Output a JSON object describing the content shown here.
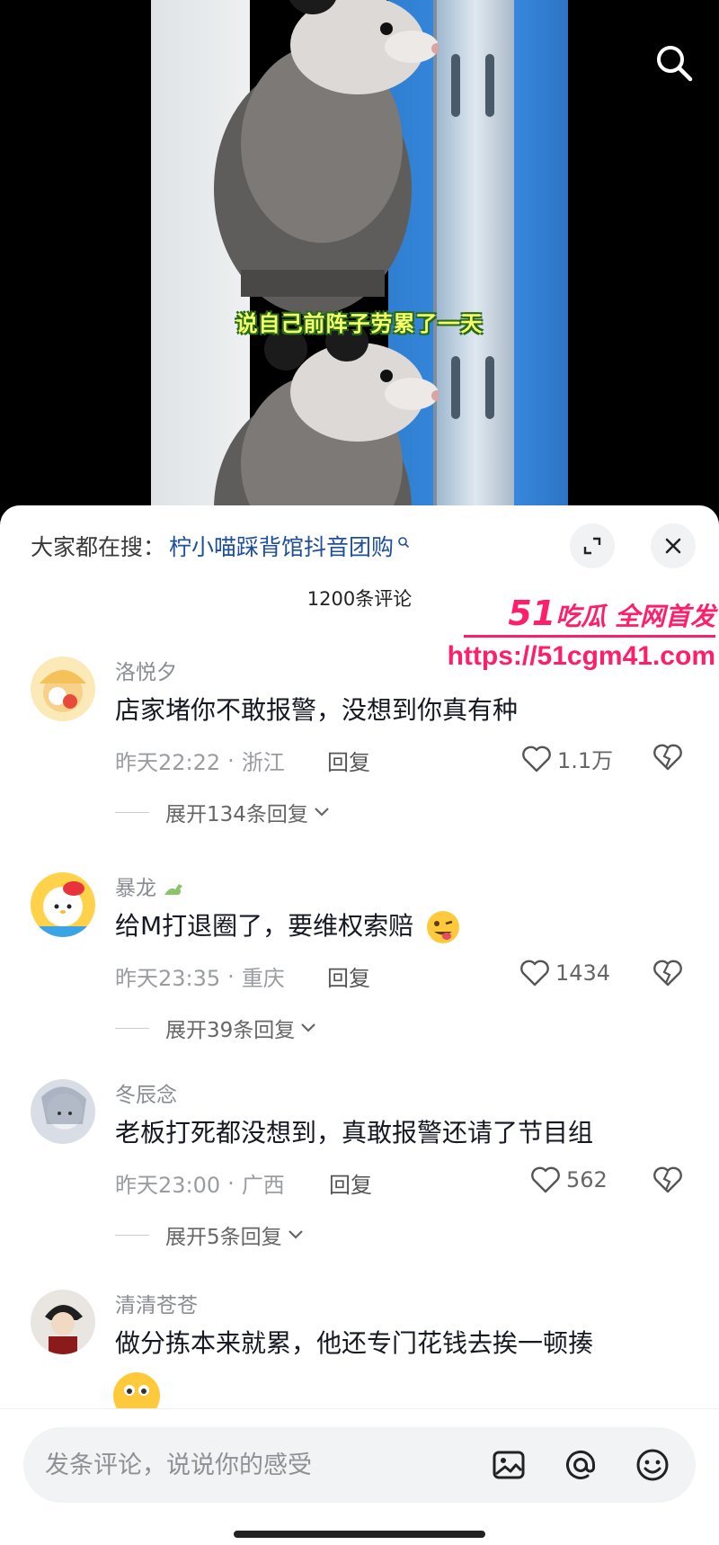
{
  "video": {
    "subtitle": "说自己前阵子劳累了一天"
  },
  "sheet": {
    "search_prefix": "大家都在搜：",
    "search_term": "柠小喵踩背馆抖音团购",
    "comment_count": "1200条评论"
  },
  "comments": [
    {
      "user": "洛悦夕",
      "text": "店家堵你不敢报警，没想到你真有种",
      "time": "昨天22:22",
      "location": "浙江",
      "reply": "回复",
      "likes": "1.1万",
      "expand": "展开134条回复"
    },
    {
      "user": "暴龙",
      "text": "给M打退圈了，要维权索赔",
      "time": "昨天23:35",
      "location": "重庆",
      "reply": "回复",
      "likes": "1434",
      "expand": "展开39条回复"
    },
    {
      "user": "冬辰念",
      "text": "老板打死都没想到，真敢报警还请了节目组",
      "time": "昨天23:00",
      "location": "广西",
      "reply": "回复",
      "likes": "562",
      "expand": "展开5条回复"
    },
    {
      "user": "清清苍苍",
      "text": "做分拣本来就累，他还专门花钱去挨一顿揍"
    }
  ],
  "watermark": {
    "big": "51",
    "title": "吃瓜 全网首发",
    "url": "https://51cgm41.com"
  },
  "input": {
    "placeholder": "发条评论，说说你的感受"
  },
  "colors": {
    "accent_link": "#1e4f9c",
    "watermark": "#ff1e6a"
  }
}
